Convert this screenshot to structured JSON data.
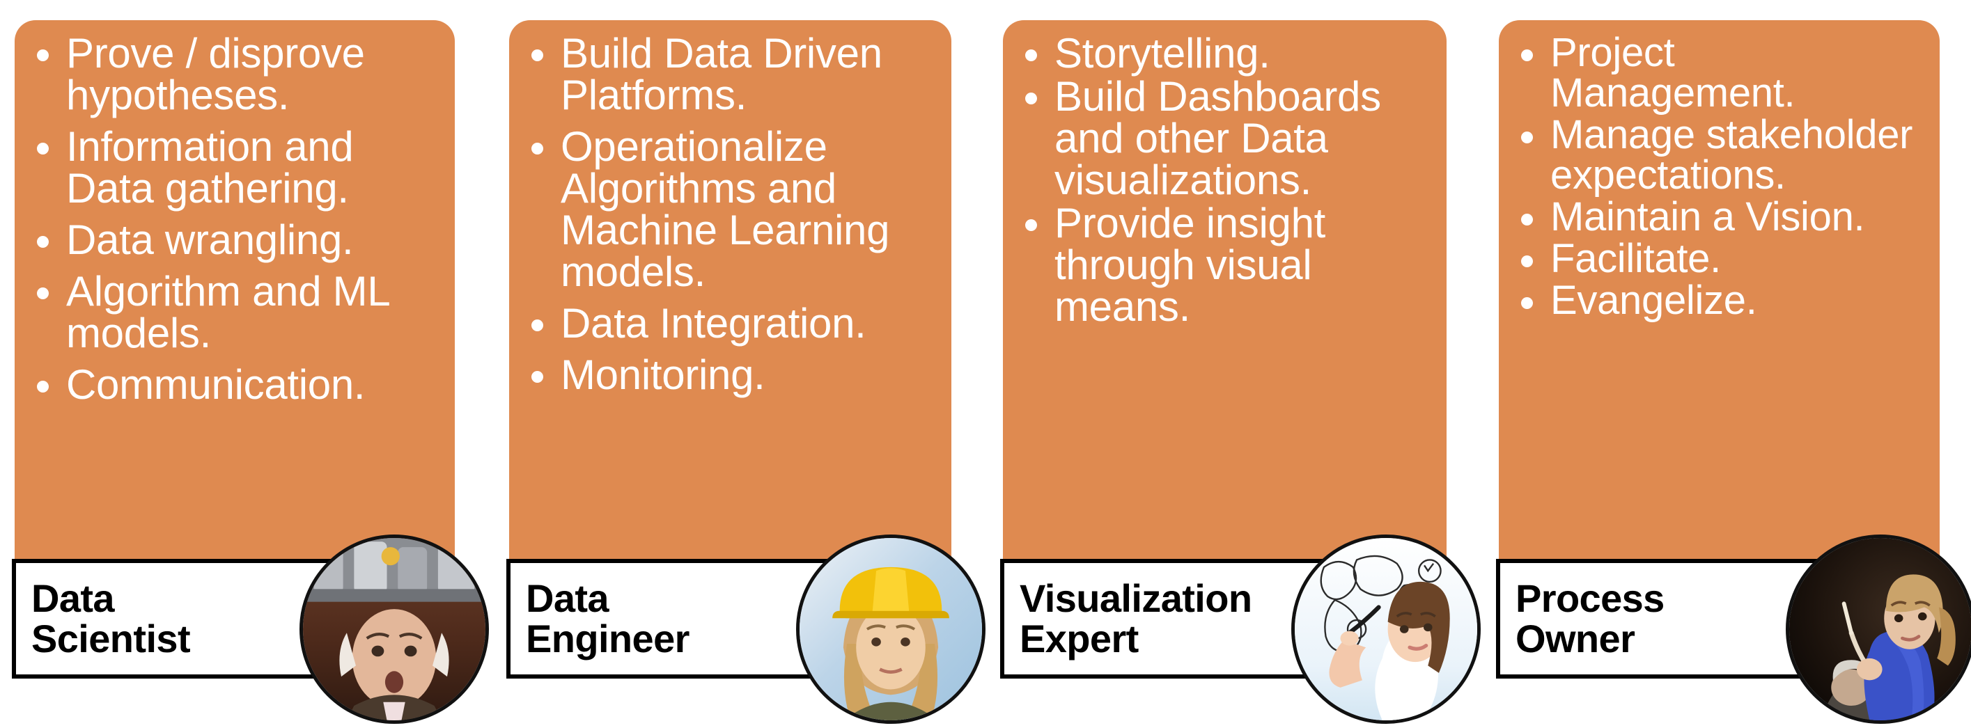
{
  "theme": {
    "card_fill": "#df8a50",
    "bullet_color": "#ffffff",
    "plate_fill": "#ffffff",
    "plate_border": "#000000",
    "title_color": "#000000",
    "page_background": "#ffffff"
  },
  "cards": [
    {
      "id": "data-scientist",
      "title": "Data\nScientist",
      "avatar_icon": "scientist-portrait-icon",
      "avatar_alt": "Older man wearing a metallic brain-wave helmet",
      "bullets": [
        "Prove / disprove hypotheses.",
        "Information and Data gathering.",
        "Data wrangling.",
        "Algorithm and ML models.",
        "Communication."
      ]
    },
    {
      "id": "data-engineer",
      "title": "Data\nEngineer",
      "avatar_icon": "engineer-portrait-icon",
      "avatar_alt": "Woman wearing a yellow hard hat",
      "bullets": [
        "Build Data Driven Platforms.",
        "Operationalize Algorithms and Machine Learning models.",
        "Data Integration.",
        "Monitoring."
      ]
    },
    {
      "id": "visualization-expert",
      "title": "Visualization\nExpert",
      "avatar_icon": "visualization-expert-portrait-icon",
      "avatar_alt": "Woman drawing a world map on a glass surface",
      "bullets": [
        "Storytelling.",
        "Build Dashboards and other Data visualizations.",
        "Provide insight through visual means."
      ]
    },
    {
      "id": "process-owner",
      "title": "Process\nOwner",
      "avatar_icon": "process-owner-portrait-icon",
      "avatar_alt": "Woman conducting an orchestra with a baton",
      "bullets": [
        "Project Management.",
        "Manage stakeholder expectations.",
        "Maintain a Vision.",
        "Facilitate.",
        "Evangelize."
      ]
    }
  ]
}
